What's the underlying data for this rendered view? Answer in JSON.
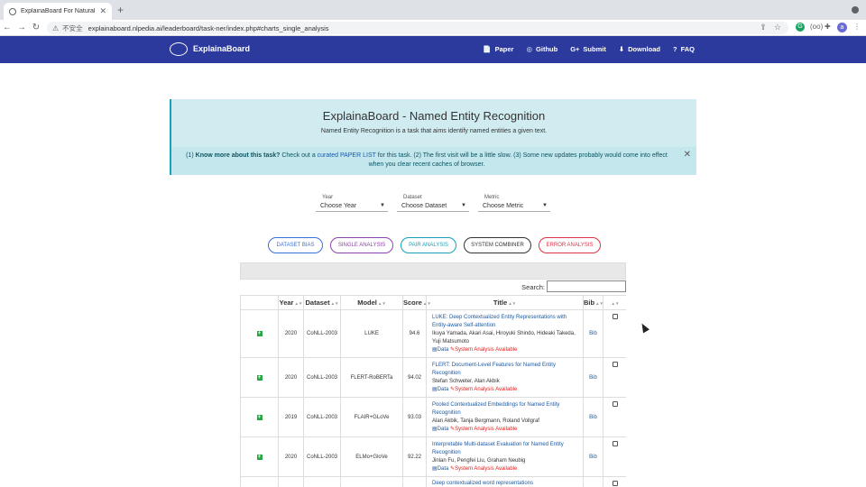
{
  "browser": {
    "tab_title": "ExplainaBoard For Natural Lan",
    "new_tab": "+",
    "security_label": "不安全",
    "url": "explainaboard.nlpedia.ai/leaderboard/task-ner/index.php#charts_single_analysis",
    "ext_label": "(oo)"
  },
  "site": {
    "brand": "ExplainaBoard",
    "nav": [
      {
        "icon": "📄",
        "label": "Paper"
      },
      {
        "icon": "◎",
        "label": "Github"
      },
      {
        "icon": "G+",
        "label": "Submit"
      },
      {
        "icon": "⬇",
        "label": "Download"
      },
      {
        "icon": "?",
        "label": "FAQ"
      }
    ]
  },
  "banner": {
    "title": "ExplainaBoard - Named Entity Recognition",
    "subtitle": "Named Entity Recognition is a task that aims identify named entities a given text.",
    "notice_p1": "(1) ",
    "notice_bold": "Know more about this task?",
    "notice_p2": " Check out a ",
    "notice_link": "curated PAPER LIST",
    "notice_p3": " for this task. (2) The first visit will be a little slow. (3) Some new updates probably would come into effect when you clear recent caches of browser."
  },
  "filters": [
    {
      "label": "Year",
      "value": "Choose Year"
    },
    {
      "label": "Dataset",
      "value": "Choose Dataset"
    },
    {
      "label": "Metric",
      "value": "Choose Metric"
    }
  ],
  "analysis_buttons": [
    {
      "label": "DATASET BIAS",
      "color": "#3b6fd8"
    },
    {
      "label": "SINGLE ANALYSIS",
      "color": "#8e44ad"
    },
    {
      "label": "PAIR ANALYSIS",
      "color": "#17a2b8"
    },
    {
      "label": "SYSTEM COMBINER",
      "color": "#333333"
    },
    {
      "label": "ERROR ANALYSIS",
      "color": "#dc3545"
    }
  ],
  "table": {
    "search_label": "Search:",
    "headers": [
      "",
      "Year",
      "Dataset",
      "Model",
      "Score",
      "Title",
      "Bib",
      ""
    ],
    "rows": [
      {
        "year": "2020",
        "dataset": "CoNLL-2003",
        "model": "LUKE",
        "score": "94.6",
        "title": "LUKE: Deep Contextualized Entity Representations with Entity-aware Self-attention",
        "authors": "Ikuya Yamada, Akari Asai, Hiroyuki Shindo, Hideaki Takeda, Yuji Matsumoto",
        "data": "Data",
        "system": "System Analysis Available",
        "bib": "Bib"
      },
      {
        "year": "2020",
        "dataset": "CoNLL-2003",
        "model": "FLERT-RoBERTa",
        "score": "94.02",
        "title": "FLERT: Document-Level Features for Named Entity Recognition",
        "authors": "Stefan Schweter, Alan Akbik",
        "data": "Data",
        "system": "System Analysis Available",
        "bib": "Bib"
      },
      {
        "year": "2019",
        "dataset": "CoNLL-2003",
        "model": "FLAIR+GLoVe",
        "score": "93.03",
        "title": "Pooled Contextualized Embeddings for Named Entity Recognition",
        "authors": "Alan Akbik, Tanja Bergmann, Roland Vollgraf",
        "data": "Data",
        "system": "System Analysis Available",
        "bib": "Bib"
      },
      {
        "year": "2020",
        "dataset": "CoNLL-2003",
        "model": "ELMo+GloVe",
        "score": "92.22",
        "title": "Interpretable Multi-dataset Evaluation for Named Entity Recognition",
        "authors": "Jinlan Fu, Pengfei Liu, Graham Neubig",
        "data": "Data",
        "system": "System Analysis Available",
        "bib": "Bib"
      },
      {
        "year": "",
        "dataset": "",
        "model": "",
        "score": "",
        "title": "Deep contextualized word representations",
        "authors": "",
        "data": "",
        "system": "",
        "bib": ""
      }
    ]
  }
}
